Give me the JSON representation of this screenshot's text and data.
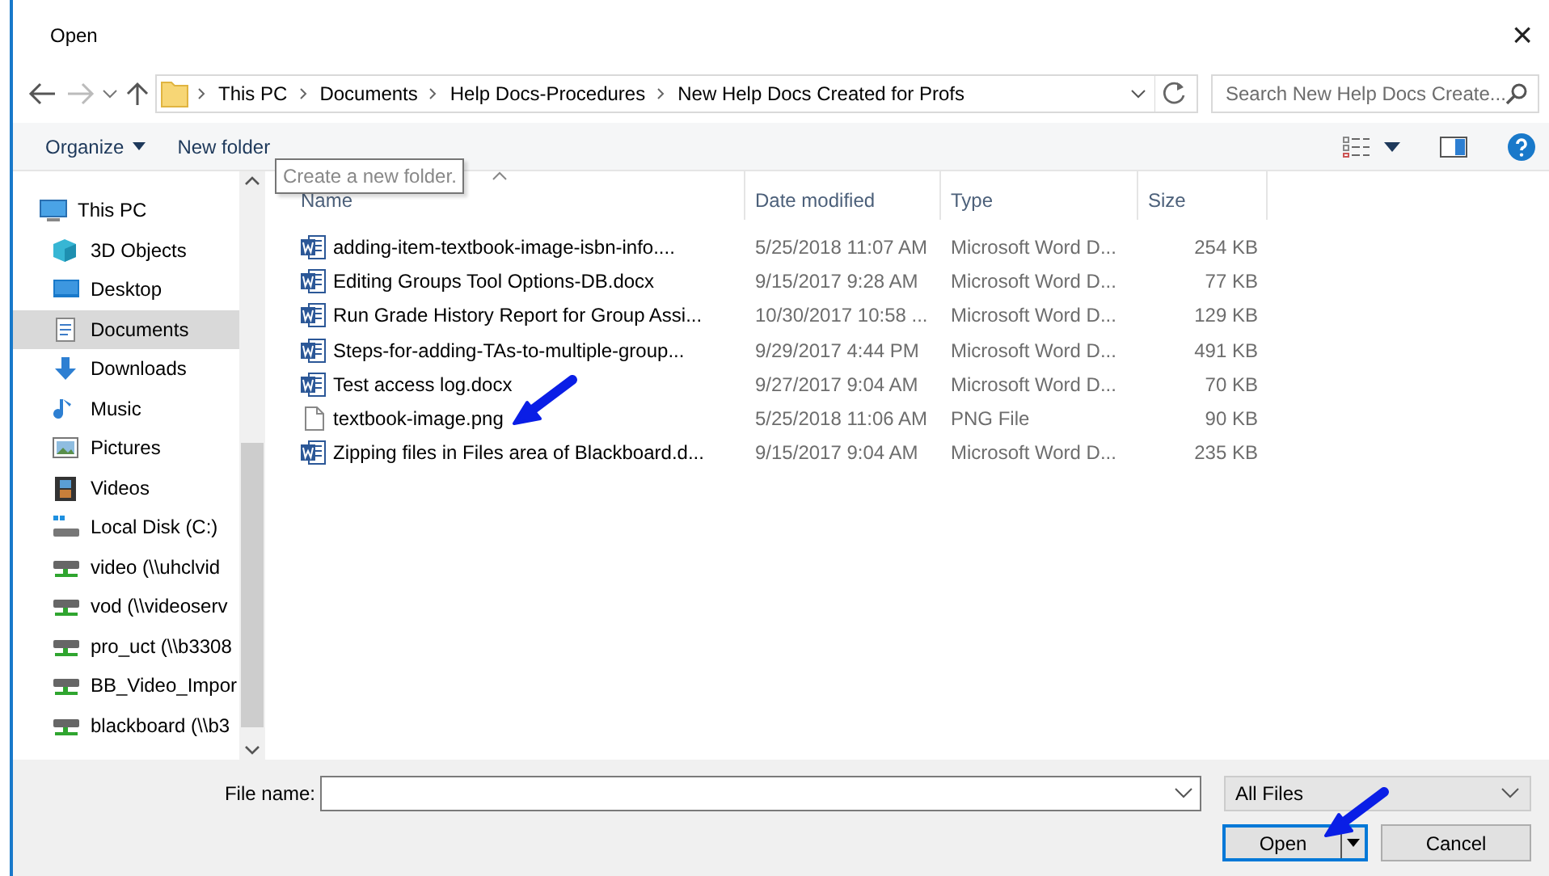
{
  "window": {
    "title": "Open",
    "close": "×"
  },
  "address_bar": {
    "crumbs": [
      "This PC",
      "Documents",
      "Help Docs-Procedures",
      "New Help Docs Created for Profs"
    ]
  },
  "search": {
    "placeholder": "Search New Help Docs Create..."
  },
  "toolbar": {
    "buttons": [
      {
        "label": "Organize",
        "dropdown": true
      },
      {
        "label": "New folder",
        "dropdown": false
      }
    ]
  },
  "tooltip": "Create a new folder.",
  "nav": {
    "items": [
      {
        "label": "This PC",
        "kind": "pc",
        "selected": false,
        "children": [
          {
            "label": "3D Objects",
            "kind": "cube",
            "selected": false
          },
          {
            "label": "Desktop",
            "kind": "desktop",
            "selected": false
          },
          {
            "label": "Documents",
            "kind": "documents",
            "selected": true
          },
          {
            "label": "Downloads",
            "kind": "downloads",
            "selected": false
          },
          {
            "label": "Music",
            "kind": "music",
            "selected": false
          },
          {
            "label": "Pictures",
            "kind": "pictures",
            "selected": false
          },
          {
            "label": "Videos",
            "kind": "videos",
            "selected": false
          },
          {
            "label": "Local Disk (C:)",
            "kind": "disk",
            "selected": false
          },
          {
            "label": "video (\\\\uhclvid",
            "kind": "network",
            "selected": false
          },
          {
            "label": "vod (\\\\videoserv",
            "kind": "network",
            "selected": false
          },
          {
            "label": "pro_uct (\\\\b3308",
            "kind": "network",
            "selected": false
          },
          {
            "label": "BB_Video_Impor",
            "kind": "network",
            "selected": false
          },
          {
            "label": "blackboard (\\\\b3",
            "kind": "network",
            "selected": false
          }
        ]
      }
    ]
  },
  "files": {
    "columns": [
      {
        "label": "Name",
        "sorted": true
      },
      {
        "label": "Date modified",
        "sorted": false
      },
      {
        "label": "Type",
        "sorted": false
      },
      {
        "label": "Size",
        "sorted": false
      }
    ],
    "rows": [
      {
        "name": "adding-item-textbook-image-isbn-info....",
        "kind": "word",
        "date": "5/25/2018 11:07 AM",
        "type": "Microsoft Word D...",
        "size": "254 KB",
        "arrow": false
      },
      {
        "name": "Editing Groups Tool Options-DB.docx",
        "kind": "word",
        "date": "9/15/2017 9:28 AM",
        "type": "Microsoft Word D...",
        "size": "77 KB",
        "arrow": false
      },
      {
        "name": "Run Grade History Report for Group Assi...",
        "kind": "word",
        "date": "10/30/2017 10:58 ...",
        "type": "Microsoft Word D...",
        "size": "129 KB",
        "arrow": false
      },
      {
        "name": "Steps-for-adding-TAs-to-multiple-group...",
        "kind": "word",
        "date": "9/29/2017 4:44 PM",
        "type": "Microsoft Word D...",
        "size": "491 KB",
        "arrow": false
      },
      {
        "name": "Test access log.docx",
        "kind": "word",
        "date": "9/27/2017 9:04 AM",
        "type": "Microsoft Word D...",
        "size": "70 KB",
        "arrow": false
      },
      {
        "name": "textbook-image.png",
        "kind": "file",
        "date": "5/25/2018 11:06 AM",
        "type": "PNG File",
        "size": "90 KB",
        "arrow": true
      },
      {
        "name": "Zipping files in Files area of Blackboard.d...",
        "kind": "word",
        "date": "9/15/2017 9:04 AM",
        "type": "Microsoft Word D...",
        "size": "235 KB",
        "arrow": false
      }
    ]
  },
  "footer": {
    "file_name_label": "File name:",
    "filter": "All Files",
    "buttons": [
      {
        "label": "Open",
        "kind": "split",
        "default": true,
        "arrow": true
      },
      {
        "label": "Cancel",
        "kind": "plain",
        "default": false,
        "arrow": false
      }
    ]
  }
}
